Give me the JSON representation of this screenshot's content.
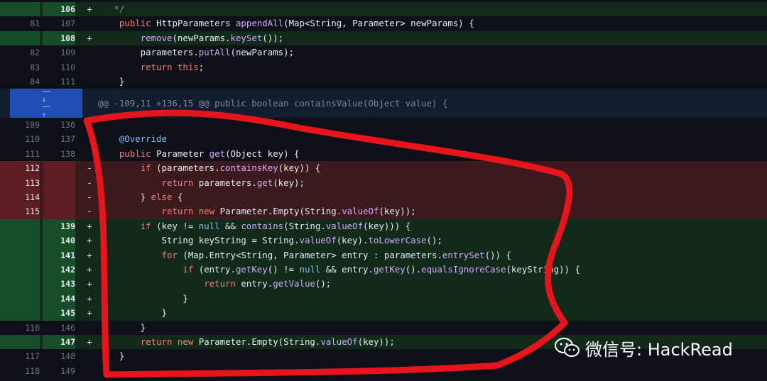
{
  "diff": {
    "rows_top": [
      {
        "type": "add",
        "old": "",
        "new": "106",
        "mark": "+",
        "tokens": [
          [
            "cm",
            "   */"
          ]
        ]
      },
      {
        "type": "ctx",
        "old": "81",
        "new": "107",
        "mark": "",
        "tokens": [
          [
            "",
            "    "
          ],
          [
            "kw",
            "public"
          ],
          [
            "",
            " HttpParameters "
          ],
          [
            "fn",
            "appendAll"
          ],
          [
            "",
            "(Map<String, Parameter> newParams) {"
          ]
        ]
      },
      {
        "type": "add",
        "old": "",
        "new": "108",
        "mark": "+",
        "tokens": [
          [
            "",
            "        "
          ],
          [
            "fn",
            "remove"
          ],
          [
            "",
            "(newParams."
          ],
          [
            "fn",
            "keySet"
          ],
          [
            "",
            "());"
          ]
        ]
      },
      {
        "type": "ctx",
        "old": "82",
        "new": "109",
        "mark": "",
        "tokens": [
          [
            "",
            "        parameters."
          ],
          [
            "fn",
            "putAll"
          ],
          [
            "",
            "(newParams);"
          ]
        ]
      },
      {
        "type": "ctx",
        "old": "83",
        "new": "110",
        "mark": "",
        "tokens": [
          [
            "",
            "        "
          ],
          [
            "kw",
            "return"
          ],
          [
            "",
            " "
          ],
          [
            "kw",
            "this"
          ],
          [
            "",
            ";"
          ]
        ]
      },
      {
        "type": "ctx",
        "old": "84",
        "new": "111",
        "mark": "",
        "tokens": [
          [
            "",
            "    }"
          ]
        ]
      }
    ],
    "hunk_header": "@@ -109,11 +136,15 @@ public boolean containsValue(Object value) {",
    "rows_bottom": [
      {
        "type": "ctx",
        "old": "109",
        "new": "136",
        "mark": "",
        "tokens": [
          [
            "",
            ""
          ]
        ]
      },
      {
        "type": "ctx",
        "old": "110",
        "new": "137",
        "mark": "",
        "tokens": [
          [
            "",
            "    "
          ],
          [
            "ann",
            "@Override"
          ]
        ]
      },
      {
        "type": "ctx",
        "old": "111",
        "new": "138",
        "mark": "",
        "tokens": [
          [
            "",
            "    "
          ],
          [
            "kw",
            "public"
          ],
          [
            "",
            " Parameter "
          ],
          [
            "fn",
            "get"
          ],
          [
            "",
            "(Object key) {"
          ]
        ]
      },
      {
        "type": "del",
        "old": "112",
        "new": "",
        "mark": "-",
        "tokens": [
          [
            "",
            "        "
          ],
          [
            "kw",
            "if"
          ],
          [
            "",
            " (parameters."
          ],
          [
            "fn",
            "containsKey"
          ],
          [
            "",
            "(key)) {"
          ]
        ]
      },
      {
        "type": "del",
        "old": "113",
        "new": "",
        "mark": "-",
        "tokens": [
          [
            "",
            "            "
          ],
          [
            "kw",
            "return"
          ],
          [
            "",
            " parameters."
          ],
          [
            "fn",
            "get"
          ],
          [
            "",
            "(key);"
          ]
        ]
      },
      {
        "type": "del",
        "old": "114",
        "new": "",
        "mark": "-",
        "tokens": [
          [
            "",
            "        } "
          ],
          [
            "kw",
            "else"
          ],
          [
            "",
            " {"
          ]
        ]
      },
      {
        "type": "del",
        "old": "115",
        "new": "",
        "mark": "-",
        "tokens": [
          [
            "",
            "            "
          ],
          [
            "kw",
            "return"
          ],
          [
            "",
            " "
          ],
          [
            "kw",
            "new"
          ],
          [
            "",
            " Parameter.Empty(String."
          ],
          [
            "fn",
            "valueOf"
          ],
          [
            "",
            "(key));"
          ]
        ]
      },
      {
        "type": "add",
        "old": "",
        "new": "139",
        "mark": "+",
        "tokens": [
          [
            "",
            "        "
          ],
          [
            "kw",
            "if"
          ],
          [
            "",
            " (key != "
          ],
          [
            "lit",
            "null"
          ],
          [
            "",
            " && "
          ],
          [
            "fn",
            "contains"
          ],
          [
            "",
            "(String."
          ],
          [
            "fn",
            "valueOf"
          ],
          [
            "",
            "(key))) {"
          ]
        ]
      },
      {
        "type": "add",
        "old": "",
        "new": "140",
        "mark": "+",
        "tokens": [
          [
            "",
            "            String keyString = String."
          ],
          [
            "fn",
            "valueOf"
          ],
          [
            "",
            "(key)."
          ],
          [
            "fn",
            "toLowerCase"
          ],
          [
            "",
            "();"
          ]
        ]
      },
      {
        "type": "add",
        "old": "",
        "new": "141",
        "mark": "+",
        "tokens": [
          [
            "",
            "            "
          ],
          [
            "kw",
            "for"
          ],
          [
            "",
            " (Map.Entry<String, Parameter> entry : parameters."
          ],
          [
            "fn",
            "entrySet"
          ],
          [
            "",
            "()) {"
          ]
        ]
      },
      {
        "type": "add",
        "old": "",
        "new": "142",
        "mark": "+",
        "tokens": [
          [
            "",
            "                "
          ],
          [
            "kw",
            "if"
          ],
          [
            "",
            " (entry."
          ],
          [
            "fn",
            "getKey"
          ],
          [
            "",
            "() != "
          ],
          [
            "lit",
            "null"
          ],
          [
            "",
            " && entry."
          ],
          [
            "fn",
            "getKey"
          ],
          [
            "",
            "()."
          ],
          [
            "fn",
            "equalsIgnoreCase"
          ],
          [
            "",
            "(keyString)) {"
          ]
        ]
      },
      {
        "type": "add",
        "old": "",
        "new": "143",
        "mark": "+",
        "tokens": [
          [
            "",
            "                    "
          ],
          [
            "kw",
            "return"
          ],
          [
            "",
            " entry."
          ],
          [
            "fn",
            "getValue"
          ],
          [
            "",
            "();"
          ]
        ]
      },
      {
        "type": "add",
        "old": "",
        "new": "144",
        "mark": "+",
        "tokens": [
          [
            "",
            "                }"
          ]
        ]
      },
      {
        "type": "add",
        "old": "",
        "new": "145",
        "mark": "+",
        "tokens": [
          [
            "",
            "            }"
          ]
        ]
      },
      {
        "type": "ctx",
        "old": "116",
        "new": "146",
        "mark": "",
        "tokens": [
          [
            "",
            "        }"
          ]
        ]
      },
      {
        "type": "add",
        "old": "",
        "new": "147",
        "mark": "+",
        "tokens": [
          [
            "",
            "        "
          ],
          [
            "kw",
            "return"
          ],
          [
            "",
            " "
          ],
          [
            "kw",
            "new"
          ],
          [
            "",
            " Parameter.Empty(String."
          ],
          [
            "fn",
            "valueOf"
          ],
          [
            "",
            "(key));"
          ]
        ]
      },
      {
        "type": "ctx",
        "old": "117",
        "new": "148",
        "mark": "",
        "tokens": [
          [
            "",
            "    }"
          ]
        ]
      },
      {
        "type": "ctx",
        "old": "118",
        "new": "149",
        "mark": "",
        "tokens": [
          [
            "",
            ""
          ]
        ]
      }
    ]
  },
  "expand": {
    "down_icon": "expand-down-icon",
    "up_icon": "expand-up-icon"
  },
  "watermark": {
    "text": "微信号: HackRead",
    "icon": "wechat-icon"
  },
  "annotation": {
    "color": "#e8141c",
    "shape": "hand-drawn-outline"
  }
}
